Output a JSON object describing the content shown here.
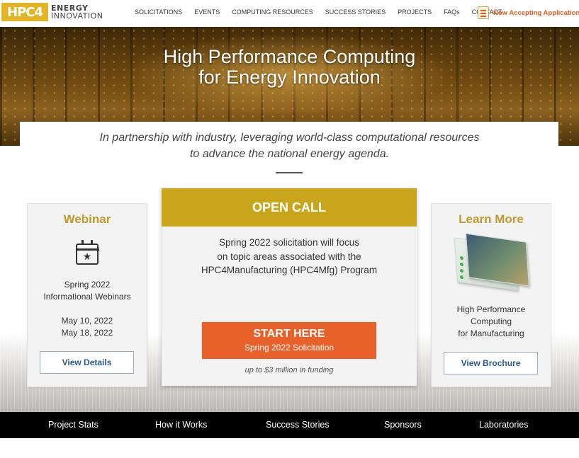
{
  "header": {
    "logo": {
      "mark": "HPC4",
      "line1": "ENERGY",
      "line2": "INNOVATION"
    },
    "nav": [
      "SOLICITATIONS",
      "EVENTS",
      "COMPUTING RESOURCES",
      "SUCCESS STORIES",
      "PROJECTS",
      "FAQs",
      "CONTACT"
    ],
    "accepting": {
      "icon": "document-icon",
      "label": "Now Accepting Applications"
    }
  },
  "hero": {
    "title_line1": "High Performance Computing",
    "title_line2": "for Energy Innovation"
  },
  "intro": {
    "line1": "In partnership with industry, leveraging world-class computational resources",
    "line2": "to advance the national energy agenda."
  },
  "webinar": {
    "title": "Webinar",
    "icon": "calendar-star-icon",
    "text_line1": "Spring 2022",
    "text_line2": "Informational Webinars",
    "date1": "May 10, 2022",
    "date2": "May 18, 2022",
    "button": "View Details"
  },
  "open_call": {
    "title": "OPEN CALL",
    "line1": "Spring 2022 solicitation will focus",
    "line2": "on topic areas associated with the",
    "line3": "HPC4Manufacturing (HPC4Mfg) Program",
    "button_main": "START HERE",
    "button_sub": "Spring 2022 Solicitation",
    "funding": "up to $3 million in funding"
  },
  "learn_more": {
    "title": "Learn More",
    "image": "brochure-image",
    "text_line1": "High Performance",
    "text_line2": "Computing",
    "text_line3": "for Manufacturing",
    "button": "View Brochure"
  },
  "footer": [
    "Project Stats",
    "How it Works",
    "Success Stories",
    "Sponsors",
    "Laboratories"
  ],
  "colors": {
    "gold": "#c9a51b",
    "orange": "#e8602a",
    "link_blue": "#285a8c"
  }
}
